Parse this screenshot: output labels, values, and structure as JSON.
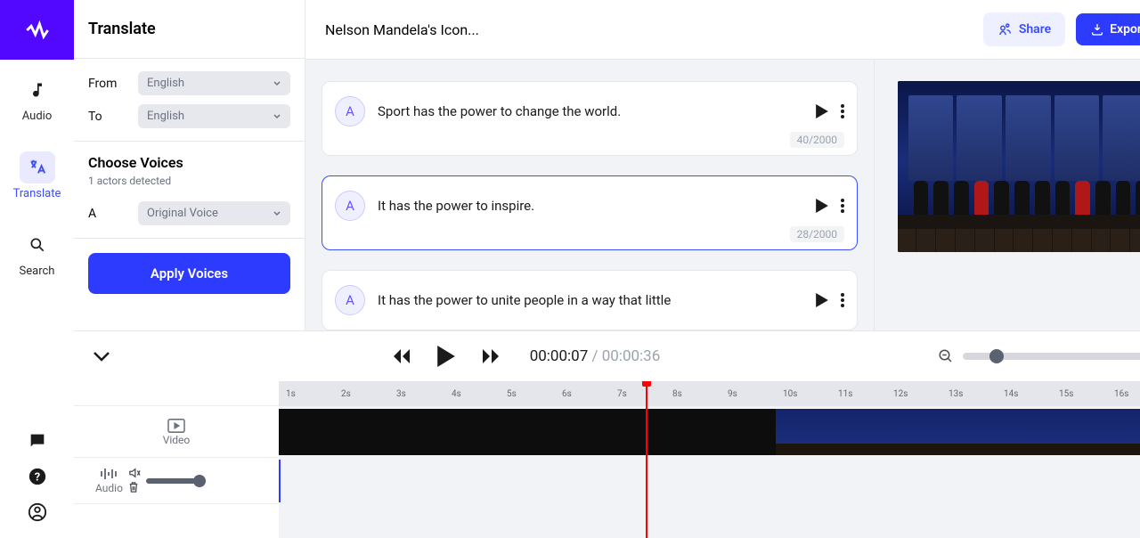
{
  "rail": {
    "audio": "Audio",
    "translate": "Translate",
    "search": "Search"
  },
  "side": {
    "title": "Translate",
    "from_label": "From",
    "from_value": "English",
    "to_label": "To",
    "to_value": "English",
    "voices_title": "Choose Voices",
    "voices_sub": "1 actors detected",
    "actor_letter": "A",
    "actor_voice": "Original Voice",
    "apply_btn": "Apply Voices"
  },
  "header": {
    "project_title": "Nelson Mandela's Icon...",
    "share": "Share",
    "export": "Export"
  },
  "lines": [
    {
      "letter": "A",
      "text": "Sport has the power to change the world.",
      "count": "40/2000",
      "selected": false
    },
    {
      "letter": "A",
      "text": "It has the power to inspire.",
      "count": "28/2000",
      "selected": true
    },
    {
      "letter": "A",
      "text": "It has the power to unite people in a way that little",
      "count": "",
      "selected": false
    }
  ],
  "timeline": {
    "current": "00:00:07",
    "duration": "00:00:36",
    "ruler": [
      "1s",
      "2s",
      "3s",
      "4s",
      "5s",
      "6s",
      "7s",
      "8s",
      "9s",
      "10s",
      "11s",
      "12s",
      "13s",
      "14s",
      "15s",
      "16s"
    ],
    "video_label": "Video",
    "audio_label": "Audio"
  }
}
